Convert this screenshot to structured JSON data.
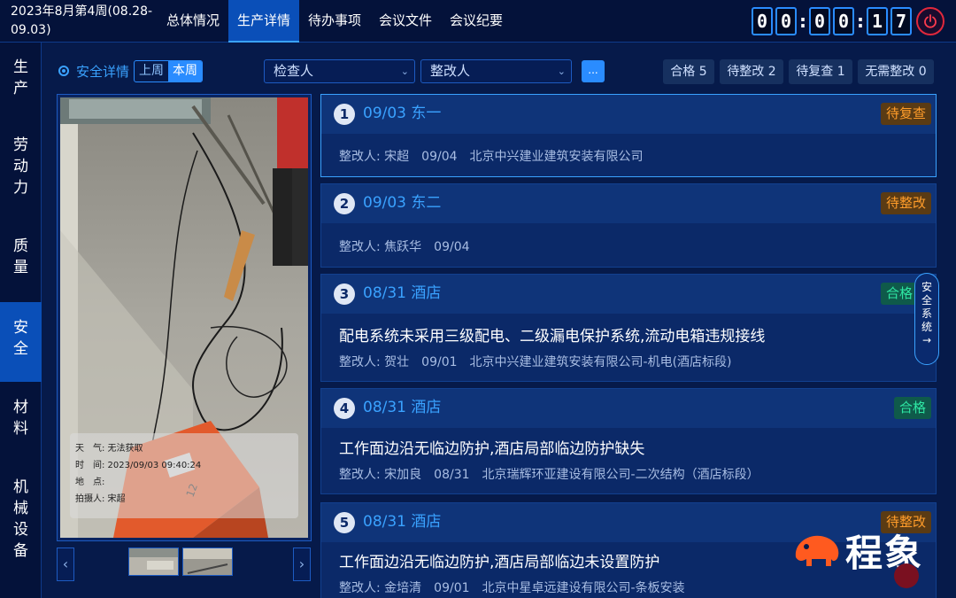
{
  "header": {
    "week_label": "2023年8月第4周(08.28-09.03)",
    "tabs": [
      {
        "label": "总体情况"
      },
      {
        "label": "生产详情"
      },
      {
        "label": "待办事项"
      },
      {
        "label": "会议文件"
      },
      {
        "label": "会议纪要"
      }
    ],
    "active_tab": "生产详情",
    "timer": [
      "0",
      "0",
      ":",
      "0",
      "0",
      ":",
      "1",
      "7"
    ]
  },
  "sidebar": {
    "items": [
      {
        "label": "生\n产"
      },
      {
        "label": "劳\n动\n力"
      },
      {
        "label": "质\n量"
      },
      {
        "label": "安\n全"
      },
      {
        "label": "材\n料"
      },
      {
        "label": "机\n械\n设\n备"
      }
    ],
    "active": "安全"
  },
  "toolbar": {
    "title": "安全详情",
    "week_options": [
      "上周",
      "本周"
    ],
    "selected_week": "本周",
    "inspector_placeholder": "检查人",
    "rectifier_placeholder": "整改人",
    "more_label": "...",
    "filters": [
      {
        "label": "合格 5"
      },
      {
        "label": "待整改 2"
      },
      {
        "label": "待复查 1"
      },
      {
        "label": "无需整改 0"
      }
    ]
  },
  "photo": {
    "info": {
      "weather": "天　气: 无法获取",
      "time": "时　间: 2023/09/03 09:40:24",
      "location": "地　点:",
      "photographer": "拍摄人: 宋超"
    },
    "sign_text": "12"
  },
  "records": [
    {
      "num": "1",
      "title": "09/03 东一",
      "status": "待复查",
      "desc": "",
      "rectifier": "整改人: 宋超",
      "date": "09/04",
      "company": "北京中兴建业建筑安装有限公司"
    },
    {
      "num": "2",
      "title": "09/03 东二",
      "status": "待整改",
      "desc": "",
      "rectifier": "整改人: 焦跃华",
      "date": "09/04",
      "company": ""
    },
    {
      "num": "3",
      "title": "08/31 酒店",
      "status": "合格",
      "desc": "配电系统未采用三级配电、二级漏电保护系统,流动电箱违规接线",
      "rectifier": "整改人: 贺壮",
      "date": "09/01",
      "company": "北京中兴建业建筑安装有限公司-机电(酒店标段)"
    },
    {
      "num": "4",
      "title": "08/31 酒店",
      "status": "合格",
      "desc": "工作面边沿无临边防护,酒店局部临边防护缺失",
      "rectifier": "整改人: 宋加良",
      "date": "08/31",
      "company": "北京瑞辉环亚建设有限公司-二次结构（酒店标段）"
    },
    {
      "num": "5",
      "title": "08/31 酒店",
      "status": "待整改",
      "desc": "工作面边沿无临边防护,酒店局部临边未设置防护",
      "rectifier": "整改人: 金培清",
      "date": "09/01",
      "company": "北京中星卓远建设有限公司-条板安装"
    }
  ],
  "side_handle": {
    "label": "安全系统→"
  },
  "logo": {
    "text": "程象"
  },
  "colors": {
    "accent": "#3aa2ff",
    "pending": "#ff9c2a",
    "ok": "#2ee6a3",
    "power": "#e0283c",
    "logo_orange": "#ff5a1f"
  }
}
